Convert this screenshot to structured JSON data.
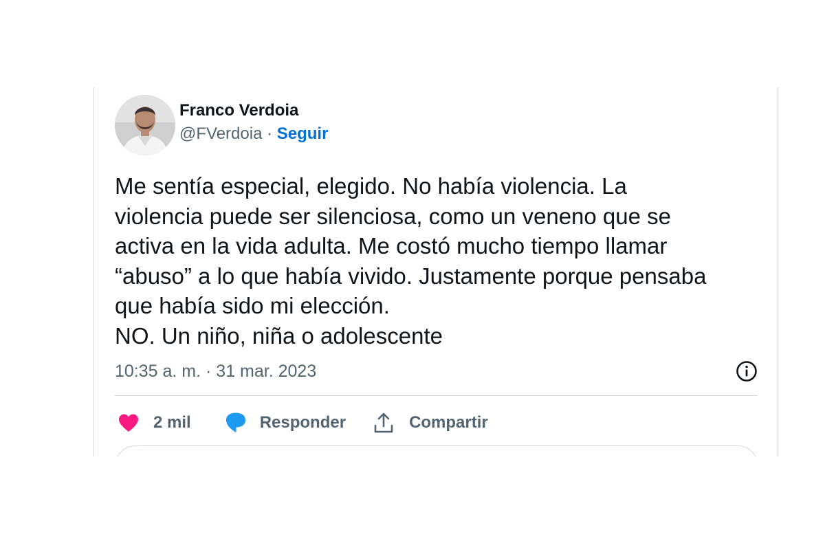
{
  "author": {
    "display_name": "Franco Verdoia",
    "handle": "@FVerdoia",
    "separator": " · ",
    "follow_label": "Seguir"
  },
  "tweet": {
    "lines": [
      "Me sentía especial, elegido. No había violencia. La",
      "violencia puede ser silenciosa, como un veneno que se",
      "activa en la vida adulta. Me costó mucho tiempo llamar",
      "“abuso” a lo que había vivido. Justamente porque pensaba",
      "que había sido mi elección.",
      "NO. Un niño, niña o adolescente"
    ],
    "timestamp": "10:35 a. m. · 31 mar. 2023"
  },
  "actions": {
    "likes_count": "2 mil",
    "reply_label": "Responder",
    "share_label": "Compartir"
  },
  "icons": {
    "info": "info-icon",
    "like": "heart-icon",
    "reply": "speech-bubble-icon",
    "share": "share-upload-icon"
  },
  "colors": {
    "text_primary": "#0f1419",
    "text_secondary": "#536471",
    "link": "#006fd6",
    "like": "#f91880",
    "reply": "#1d9bf0",
    "border": "#cfd9de"
  }
}
